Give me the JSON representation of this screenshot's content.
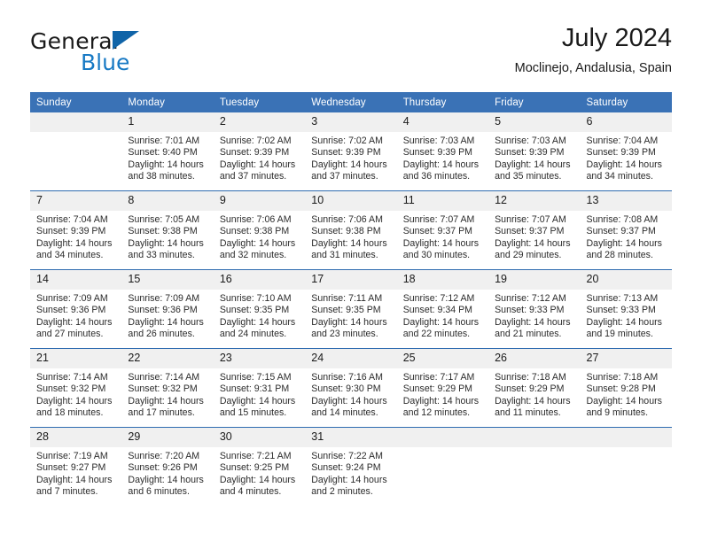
{
  "brand": {
    "name_part1": "General",
    "name_part2": "Blue",
    "triangle_color": "#1064a8",
    "blue_color": "#1779c4"
  },
  "header": {
    "title": "July 2024",
    "subtitle": "Moclinejo, Andalusia, Spain"
  },
  "theme": {
    "header_row_bg": "#3a72b6",
    "week_divider": "#2f6cb0",
    "day_number_bg": "#f0f0f0"
  },
  "weekday_headers": [
    "Sunday",
    "Monday",
    "Tuesday",
    "Wednesday",
    "Thursday",
    "Friday",
    "Saturday"
  ],
  "weeks": [
    [
      {
        "day": "",
        "lines": []
      },
      {
        "day": "1",
        "lines": [
          "Sunrise: 7:01 AM",
          "Sunset: 9:40 PM",
          "Daylight: 14 hours",
          "and 38 minutes."
        ]
      },
      {
        "day": "2",
        "lines": [
          "Sunrise: 7:02 AM",
          "Sunset: 9:39 PM",
          "Daylight: 14 hours",
          "and 37 minutes."
        ]
      },
      {
        "day": "3",
        "lines": [
          "Sunrise: 7:02 AM",
          "Sunset: 9:39 PM",
          "Daylight: 14 hours",
          "and 37 minutes."
        ]
      },
      {
        "day": "4",
        "lines": [
          "Sunrise: 7:03 AM",
          "Sunset: 9:39 PM",
          "Daylight: 14 hours",
          "and 36 minutes."
        ]
      },
      {
        "day": "5",
        "lines": [
          "Sunrise: 7:03 AM",
          "Sunset: 9:39 PM",
          "Daylight: 14 hours",
          "and 35 minutes."
        ]
      },
      {
        "day": "6",
        "lines": [
          "Sunrise: 7:04 AM",
          "Sunset: 9:39 PM",
          "Daylight: 14 hours",
          "and 34 minutes."
        ]
      }
    ],
    [
      {
        "day": "7",
        "lines": [
          "Sunrise: 7:04 AM",
          "Sunset: 9:39 PM",
          "Daylight: 14 hours",
          "and 34 minutes."
        ]
      },
      {
        "day": "8",
        "lines": [
          "Sunrise: 7:05 AM",
          "Sunset: 9:38 PM",
          "Daylight: 14 hours",
          "and 33 minutes."
        ]
      },
      {
        "day": "9",
        "lines": [
          "Sunrise: 7:06 AM",
          "Sunset: 9:38 PM",
          "Daylight: 14 hours",
          "and 32 minutes."
        ]
      },
      {
        "day": "10",
        "lines": [
          "Sunrise: 7:06 AM",
          "Sunset: 9:38 PM",
          "Daylight: 14 hours",
          "and 31 minutes."
        ]
      },
      {
        "day": "11",
        "lines": [
          "Sunrise: 7:07 AM",
          "Sunset: 9:37 PM",
          "Daylight: 14 hours",
          "and 30 minutes."
        ]
      },
      {
        "day": "12",
        "lines": [
          "Sunrise: 7:07 AM",
          "Sunset: 9:37 PM",
          "Daylight: 14 hours",
          "and 29 minutes."
        ]
      },
      {
        "day": "13",
        "lines": [
          "Sunrise: 7:08 AM",
          "Sunset: 9:37 PM",
          "Daylight: 14 hours",
          "and 28 minutes."
        ]
      }
    ],
    [
      {
        "day": "14",
        "lines": [
          "Sunrise: 7:09 AM",
          "Sunset: 9:36 PM",
          "Daylight: 14 hours",
          "and 27 minutes."
        ]
      },
      {
        "day": "15",
        "lines": [
          "Sunrise: 7:09 AM",
          "Sunset: 9:36 PM",
          "Daylight: 14 hours",
          "and 26 minutes."
        ]
      },
      {
        "day": "16",
        "lines": [
          "Sunrise: 7:10 AM",
          "Sunset: 9:35 PM",
          "Daylight: 14 hours",
          "and 24 minutes."
        ]
      },
      {
        "day": "17",
        "lines": [
          "Sunrise: 7:11 AM",
          "Sunset: 9:35 PM",
          "Daylight: 14 hours",
          "and 23 minutes."
        ]
      },
      {
        "day": "18",
        "lines": [
          "Sunrise: 7:12 AM",
          "Sunset: 9:34 PM",
          "Daylight: 14 hours",
          "and 22 minutes."
        ]
      },
      {
        "day": "19",
        "lines": [
          "Sunrise: 7:12 AM",
          "Sunset: 9:33 PM",
          "Daylight: 14 hours",
          "and 21 minutes."
        ]
      },
      {
        "day": "20",
        "lines": [
          "Sunrise: 7:13 AM",
          "Sunset: 9:33 PM",
          "Daylight: 14 hours",
          "and 19 minutes."
        ]
      }
    ],
    [
      {
        "day": "21",
        "lines": [
          "Sunrise: 7:14 AM",
          "Sunset: 9:32 PM",
          "Daylight: 14 hours",
          "and 18 minutes."
        ]
      },
      {
        "day": "22",
        "lines": [
          "Sunrise: 7:14 AM",
          "Sunset: 9:32 PM",
          "Daylight: 14 hours",
          "and 17 minutes."
        ]
      },
      {
        "day": "23",
        "lines": [
          "Sunrise: 7:15 AM",
          "Sunset: 9:31 PM",
          "Daylight: 14 hours",
          "and 15 minutes."
        ]
      },
      {
        "day": "24",
        "lines": [
          "Sunrise: 7:16 AM",
          "Sunset: 9:30 PM",
          "Daylight: 14 hours",
          "and 14 minutes."
        ]
      },
      {
        "day": "25",
        "lines": [
          "Sunrise: 7:17 AM",
          "Sunset: 9:29 PM",
          "Daylight: 14 hours",
          "and 12 minutes."
        ]
      },
      {
        "day": "26",
        "lines": [
          "Sunrise: 7:18 AM",
          "Sunset: 9:29 PM",
          "Daylight: 14 hours",
          "and 11 minutes."
        ]
      },
      {
        "day": "27",
        "lines": [
          "Sunrise: 7:18 AM",
          "Sunset: 9:28 PM",
          "Daylight: 14 hours",
          "and 9 minutes."
        ]
      }
    ],
    [
      {
        "day": "28",
        "lines": [
          "Sunrise: 7:19 AM",
          "Sunset: 9:27 PM",
          "Daylight: 14 hours",
          "and 7 minutes."
        ]
      },
      {
        "day": "29",
        "lines": [
          "Sunrise: 7:20 AM",
          "Sunset: 9:26 PM",
          "Daylight: 14 hours",
          "and 6 minutes."
        ]
      },
      {
        "day": "30",
        "lines": [
          "Sunrise: 7:21 AM",
          "Sunset: 9:25 PM",
          "Daylight: 14 hours",
          "and 4 minutes."
        ]
      },
      {
        "day": "31",
        "lines": [
          "Sunrise: 7:22 AM",
          "Sunset: 9:24 PM",
          "Daylight: 14 hours",
          "and 2 minutes."
        ]
      },
      {
        "day": "",
        "lines": []
      },
      {
        "day": "",
        "lines": []
      },
      {
        "day": "",
        "lines": []
      }
    ]
  ]
}
